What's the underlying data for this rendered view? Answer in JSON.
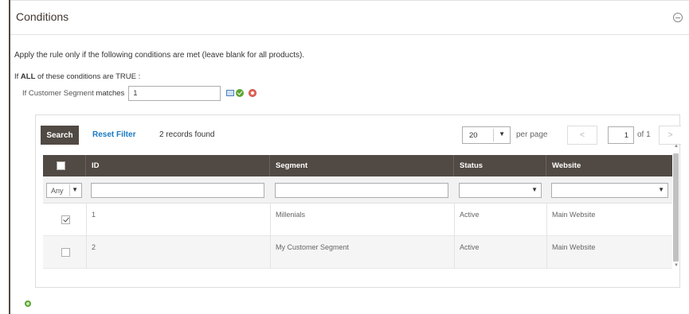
{
  "section": {
    "title": "Conditions"
  },
  "intro_text": "Apply the rule only if the following conditions are met (leave blank for all products).",
  "condition_group": {
    "prefix": "If",
    "aggregator": "ALL",
    "suffix": "of these conditions are TRUE :"
  },
  "condition": {
    "label_prefix": "If Customer Segment",
    "operator": "matches",
    "value": "1"
  },
  "grid": {
    "search_label": "Search",
    "reset_filter_label": "Reset Filter",
    "records_found": "2 records found",
    "per_page_value": "20",
    "per_page_label": "per page",
    "prev_symbol": "<",
    "next_symbol": ">",
    "current_page": "1",
    "page_total": "of 1",
    "columns": [
      "ID",
      "Segment",
      "Status",
      "Website"
    ],
    "filter_any": "Any",
    "rows": [
      {
        "checked": true,
        "id": "1",
        "segment": "Millenials",
        "status": "Active",
        "website": "Main Website"
      },
      {
        "checked": false,
        "id": "2",
        "segment": "My Customer Segment",
        "status": "Active",
        "website": "Main Website"
      }
    ]
  },
  "colors": {
    "header_bg": "#514943",
    "link": "#1979c3",
    "apply_green": "#5ca531",
    "remove_red": "#e36a5a"
  },
  "icons": [
    "collapse-icon",
    "chooser-icon",
    "apply-icon",
    "remove-icon",
    "add-condition-icon"
  ]
}
